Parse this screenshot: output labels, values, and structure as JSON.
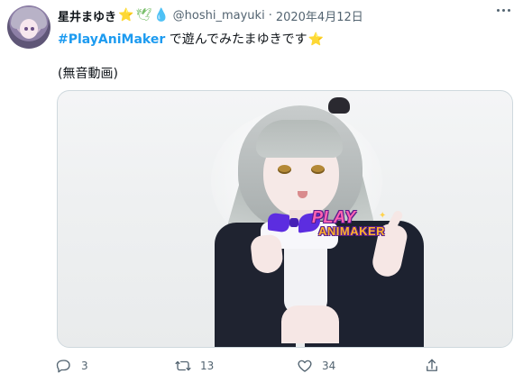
{
  "profile": {
    "name": "星井まゆき",
    "emoji_1": "⭐",
    "emoji_2": "🕊",
    "emoji_3": "💧",
    "handle": "@hoshi_mayuki",
    "separator": "·",
    "date": "2020年4月12日"
  },
  "tweet": {
    "hashtag": "#PlayAniMaker",
    "text": " で遊んでみたまゆきです",
    "emoji": "⭐",
    "subtext": "(無音動画)"
  },
  "media": {
    "logo_top": "PLAY",
    "logo_bottom": "ANIMAKER",
    "logo_sparkle": "✦"
  },
  "actions": {
    "reply_count": "3",
    "retweet_count": "13",
    "like_count": "34"
  },
  "icons": {
    "more": "more-horizontal-icon",
    "reply": "reply-icon",
    "retweet": "retweet-icon",
    "like": "heart-icon",
    "share": "share-icon"
  }
}
